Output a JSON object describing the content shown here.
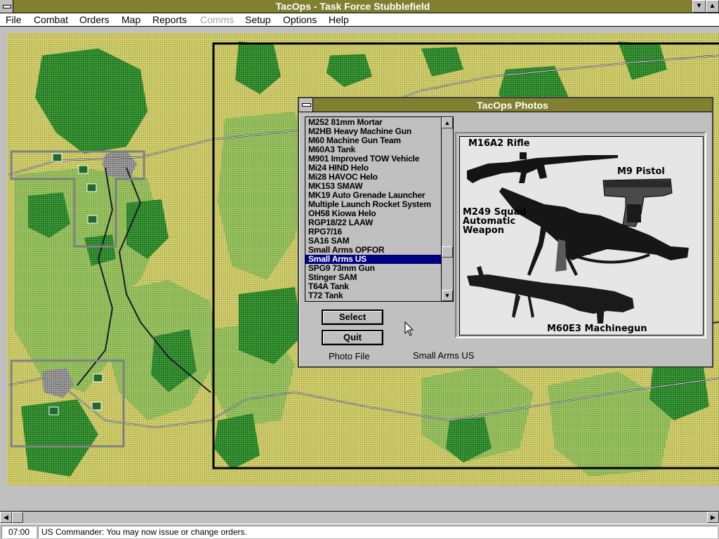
{
  "window": {
    "title": "TacOps - Task Force Stubblefield"
  },
  "menu": [
    {
      "label": "File",
      "enabled": true
    },
    {
      "label": "Combat",
      "enabled": true
    },
    {
      "label": "Orders",
      "enabled": true
    },
    {
      "label": "Map",
      "enabled": true
    },
    {
      "label": "Reports",
      "enabled": true
    },
    {
      "label": "Comms",
      "enabled": false
    },
    {
      "label": "Setup",
      "enabled": true
    },
    {
      "label": "Options",
      "enabled": true
    },
    {
      "label": "Help",
      "enabled": true
    }
  ],
  "dialog": {
    "title": "TacOps Photos",
    "list_items": [
      "M252 81mm Mortar",
      "M2HB Heavy Machine Gun",
      "M60 Machine Gun Team",
      "M60A3 Tank",
      "M901 Improved TOW Vehicle",
      "Mi24 HIND Helo",
      "Mi28 HAVOC Helo",
      "MK153 SMAW",
      "MK19 Auto Grenade Launcher",
      "Multiple Launch Rocket System",
      "OH58 Kiowa Helo",
      "RGP18/22 LAAW",
      "RPG7/16",
      "SA16 SAM",
      "Small Arms OPFOR",
      "Small Arms US",
      "SPG9 73mm Gun",
      "Stinger SAM",
      "T64A Tank",
      "T72 Tank"
    ],
    "selected_item": "Small Arms US",
    "select_label": "Select",
    "quit_label": "Quit",
    "photo_file_label": "Photo File",
    "photo_file_value": "Small Arms US",
    "photo": {
      "labels": {
        "rifle": "M16A2 Rifle",
        "pistol": "M9 Pistol",
        "saw_1": "M249 Squad",
        "saw_2": "Automatic",
        "saw_3": "Weapon",
        "mg": "M60E3 Machinegun"
      }
    }
  },
  "status": {
    "time": "07:00",
    "message": "US Commander: You may now issue or change orders."
  },
  "colors": {
    "title_bar": "#808030",
    "selection": "#000080",
    "map_light": "#d8d070",
    "map_forest": "#2e8a2e",
    "map_scrub": "#8cbc5c"
  },
  "icons": {
    "system_menu": "system-menu-icon",
    "minimize": "minimize-icon",
    "maximize": "maximize-icon",
    "arrow_cursor": "arrow-cursor-icon"
  }
}
